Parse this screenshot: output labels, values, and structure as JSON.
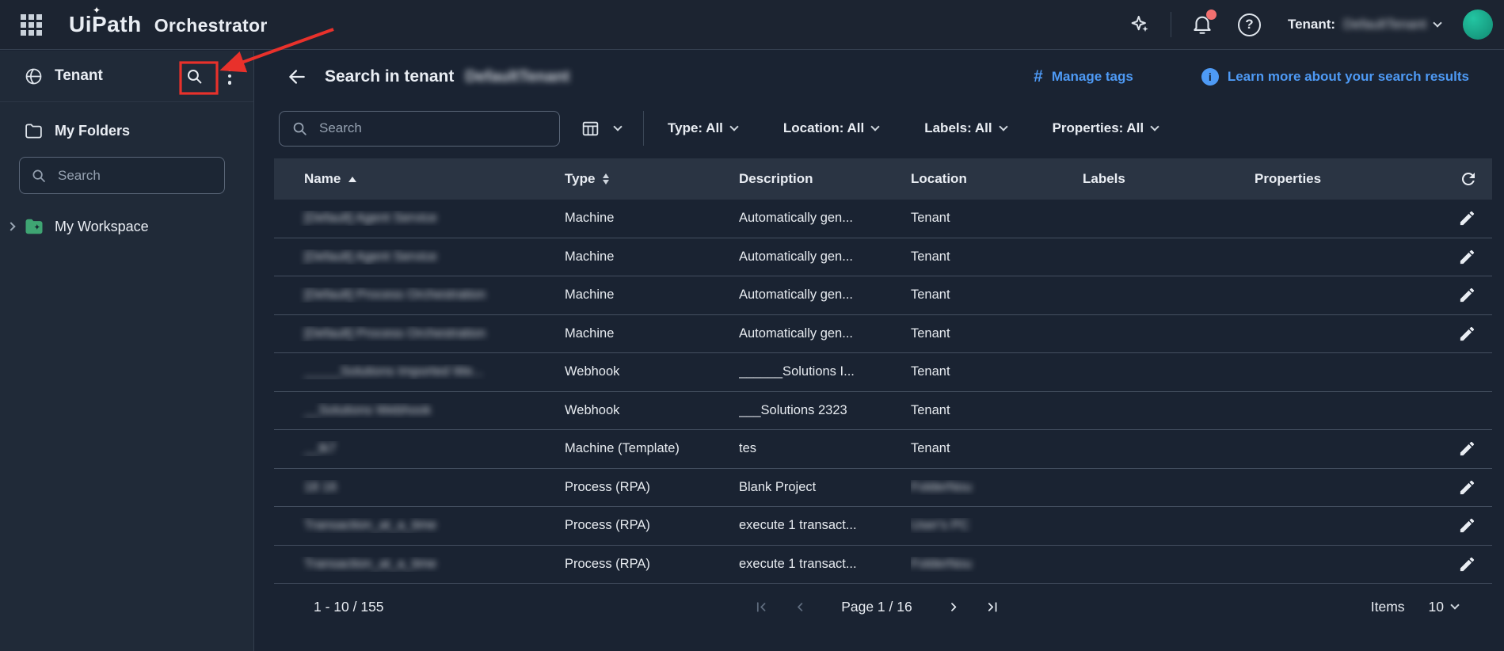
{
  "topbar": {
    "logo_primary": "UiPath",
    "logo_product": "Orchestrator",
    "tenant_label": "Tenant:",
    "tenant_name": "DefaultTenant",
    "tenant_name_blurred": true
  },
  "sidebar": {
    "title": "Tenant",
    "my_folders_label": "My Folders",
    "search_placeholder": "Search",
    "workspace_label": "My Workspace"
  },
  "main_header": {
    "title": "Search in tenant",
    "tenant_name": "DefaultTenant",
    "tenant_name_blurred": true,
    "manage_tags_label": "Manage tags",
    "learn_more_label": "Learn more about your search results"
  },
  "toolbar": {
    "search_placeholder": "Search",
    "filters": [
      {
        "id": "type",
        "label": "Type: All"
      },
      {
        "id": "location",
        "label": "Location: All"
      },
      {
        "id": "labels",
        "label": "Labels: All"
      },
      {
        "id": "properties",
        "label": "Properties: All"
      }
    ]
  },
  "table": {
    "columns": [
      {
        "label": "Name",
        "sort": "asc"
      },
      {
        "label": "Type",
        "sort": "both"
      },
      {
        "label": "Description"
      },
      {
        "label": "Location"
      },
      {
        "label": "Labels"
      },
      {
        "label": "Properties"
      }
    ],
    "rows": [
      {
        "name": "[Default] Agent Service",
        "name_blurred": true,
        "type": "Machine",
        "description": "Automatically gen...",
        "location": "Tenant",
        "location_blurred": false,
        "editable": true
      },
      {
        "name": "[Default] Agent Service",
        "name_blurred": true,
        "type": "Machine",
        "description": "Automatically gen...",
        "location": "Tenant",
        "location_blurred": false,
        "editable": true
      },
      {
        "name": "[Default] Process Orchestration",
        "name_blurred": true,
        "type": "Machine",
        "description": "Automatically gen...",
        "location": "Tenant",
        "location_blurred": false,
        "editable": true
      },
      {
        "name": "[Default] Process Orchestration",
        "name_blurred": true,
        "type": "Machine",
        "description": "Automatically gen...",
        "location": "Tenant",
        "location_blurred": false,
        "editable": true
      },
      {
        "name": "_____Solutions Imported We...",
        "name_blurred": true,
        "type": "Webhook",
        "description": "______Solutions I...",
        "location": "Tenant",
        "location_blurred": false,
        "editable": false
      },
      {
        "name": "__Solutions Webhook",
        "name_blurred": true,
        "type": "Webhook",
        "description": "___Solutions 2323",
        "location": "Tenant",
        "location_blurred": false,
        "editable": false
      },
      {
        "name": "__tk7",
        "name_blurred": true,
        "type": "Machine (Template)",
        "description": "tes",
        "location": "Tenant",
        "location_blurred": false,
        "editable": true
      },
      {
        "name": "18 16",
        "name_blurred": true,
        "type": "Process (RPA)",
        "description": "Blank Project",
        "location": "FolderNou",
        "location_blurred": true,
        "editable": true
      },
      {
        "name": "Transaction_at_a_time",
        "name_blurred": true,
        "type": "Process (RPA)",
        "description": "execute 1 transact...",
        "location": "User's PC",
        "location_blurred": true,
        "editable": true
      },
      {
        "name": "Transaction_at_a_time",
        "name_blurred": true,
        "type": "Process (RPA)",
        "description": "execute 1 transact...",
        "location": "FolderNou",
        "location_blurred": true,
        "editable": true
      }
    ]
  },
  "pagination": {
    "range_text": "1 - 10 / 155",
    "page_text": "Page 1 / 16",
    "items_label": "Items",
    "items_per_page": "10"
  },
  "colors": {
    "accent_blue": "#4e9af5",
    "annotation_red": "#e8312b",
    "avatar_teal": "#17a78c",
    "notification_dot": "#f27070",
    "table_header_bg": "#2a3443",
    "topbar_bg": "#1c2431",
    "sidebar_bg": "#202a38",
    "main_bg": "#1a2332"
  }
}
